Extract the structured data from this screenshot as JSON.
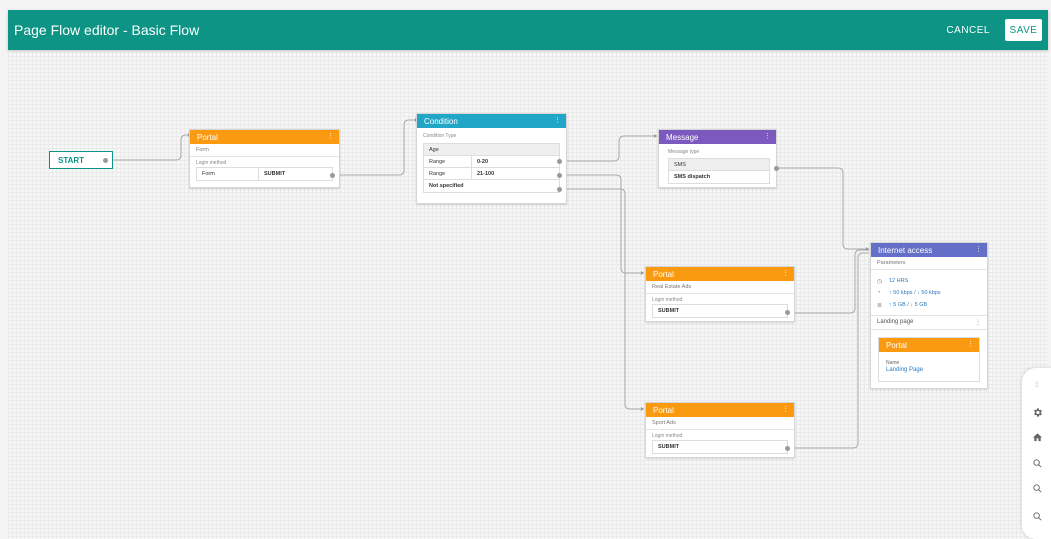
{
  "header": {
    "title": "Page Flow editor - Basic Flow",
    "cancel": "CANCEL",
    "save": "SAVE"
  },
  "start": {
    "label": "START"
  },
  "portal1": {
    "title": "Portal",
    "subtitle": "Form",
    "login_label": "Login method",
    "col1": "Form",
    "col2": "SUBMIT"
  },
  "condition": {
    "title": "Condition",
    "type_label": "Condition Type",
    "type_value": "Age",
    "rows": [
      {
        "label": "Range",
        "value": "0-20"
      },
      {
        "label": "Range",
        "value": "21-100"
      }
    ],
    "not_specified": "Not specified"
  },
  "message": {
    "title": "Message",
    "type_label": "Message type",
    "type_value": "SMS",
    "dispatch": "SMS dispatch"
  },
  "portal2": {
    "title": "Portal",
    "subtitle": "Real Estate Ads",
    "login_label": "Login method",
    "submit": "SUBMIT"
  },
  "portal3": {
    "title": "Portal",
    "subtitle": "Sport Ads",
    "login_label": "Login method",
    "submit": "SUBMIT"
  },
  "internet": {
    "title": "Internet access",
    "params_label": "Parameters",
    "time": "12 HRS",
    "speed": "↑ 50 kbps / ↓ 50 kbps",
    "data": "↑ 5 GB / ↓ 5 GB",
    "landing_label": "Landing page",
    "inner_title": "Portal",
    "name_label": "Name",
    "name_value": "Landing Page"
  },
  "icons": [
    "settings-icon",
    "gear-icon",
    "home-icon",
    "zoom-in-icon",
    "zoom-reset-icon",
    "zoom-out-icon"
  ],
  "colors": {
    "primary": "#0e9484",
    "portal": "#fa9a10",
    "condition": "#22a6c7",
    "message": "#7b59bf",
    "internet": "#6470c8"
  }
}
